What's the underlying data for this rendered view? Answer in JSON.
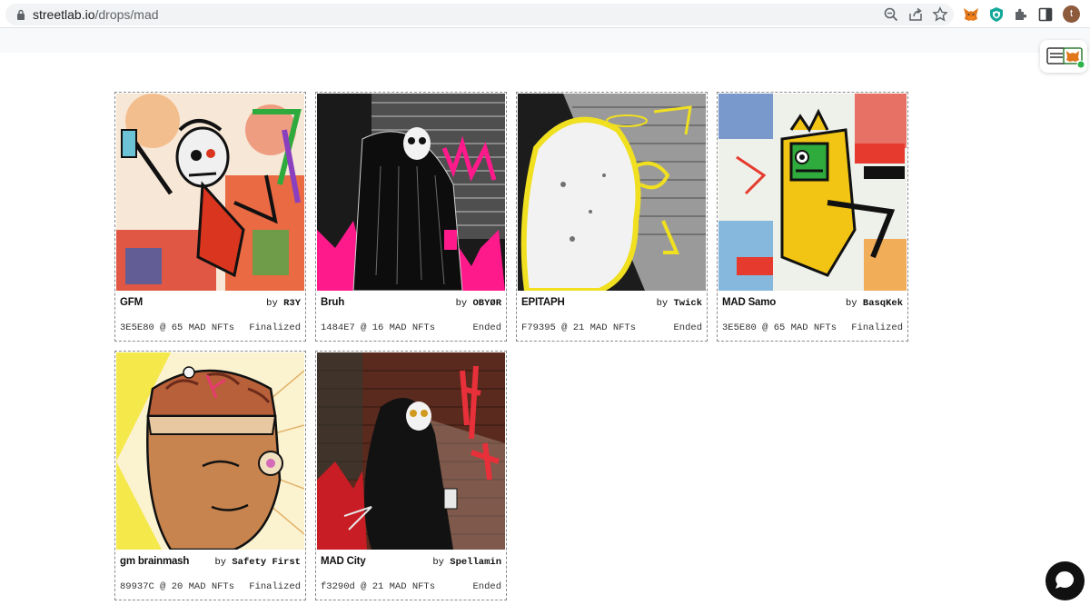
{
  "browser": {
    "url_domain": "streetlab.io",
    "url_path": "/drops/mad",
    "profile_initial": "t"
  },
  "icons": {
    "lock": "lock-icon",
    "zoom": "zoom-icon",
    "share": "share-icon",
    "bookmark": "star-icon",
    "metamask": "metamask-fox-icon",
    "shield": "shield-extension-icon",
    "extensions": "puzzle-icon",
    "sidepanel": "side-panel-icon",
    "chat": "chat-bubble-icon"
  },
  "drops": [
    {
      "title": "GFM",
      "by": "by",
      "artist": "R3Y",
      "meta": "3E5E80 @ 65 MAD NFTs",
      "status": "Finalized"
    },
    {
      "title": "Bruh",
      "by": "by",
      "artist": "OBYØR",
      "meta": "1484E7 @ 16 MAD NFTs",
      "status": "Ended"
    },
    {
      "title": "EPITAPH",
      "by": "by",
      "artist": "Twick",
      "meta": "F79395 @ 21 MAD NFTs",
      "status": "Ended"
    },
    {
      "title": "MAD Samo",
      "by": "by",
      "artist": "BasqKek",
      "meta": "3E5E80 @ 65 MAD NFTs",
      "status": "Finalized"
    },
    {
      "title": "gm brainmash",
      "by": "by",
      "artist": "Safety First",
      "meta": "89937C @ 20 MAD NFTs",
      "status": "Finalized"
    },
    {
      "title": "MAD City",
      "by": "by",
      "artist": "Spellamin",
      "meta": "f3290d @ 21 MAD NFTs",
      "status": "Ended"
    }
  ],
  "colors": {
    "card_border": "#8a8a8a",
    "chat_button": "#111111",
    "art_gfm": "#e8542a",
    "art_bruh": "#ff1a8c",
    "art_epitaph": "#f0e020",
    "art_samo": "#e63a2e",
    "art_brain": "#f5e84a",
    "art_city": "#c81d25"
  }
}
